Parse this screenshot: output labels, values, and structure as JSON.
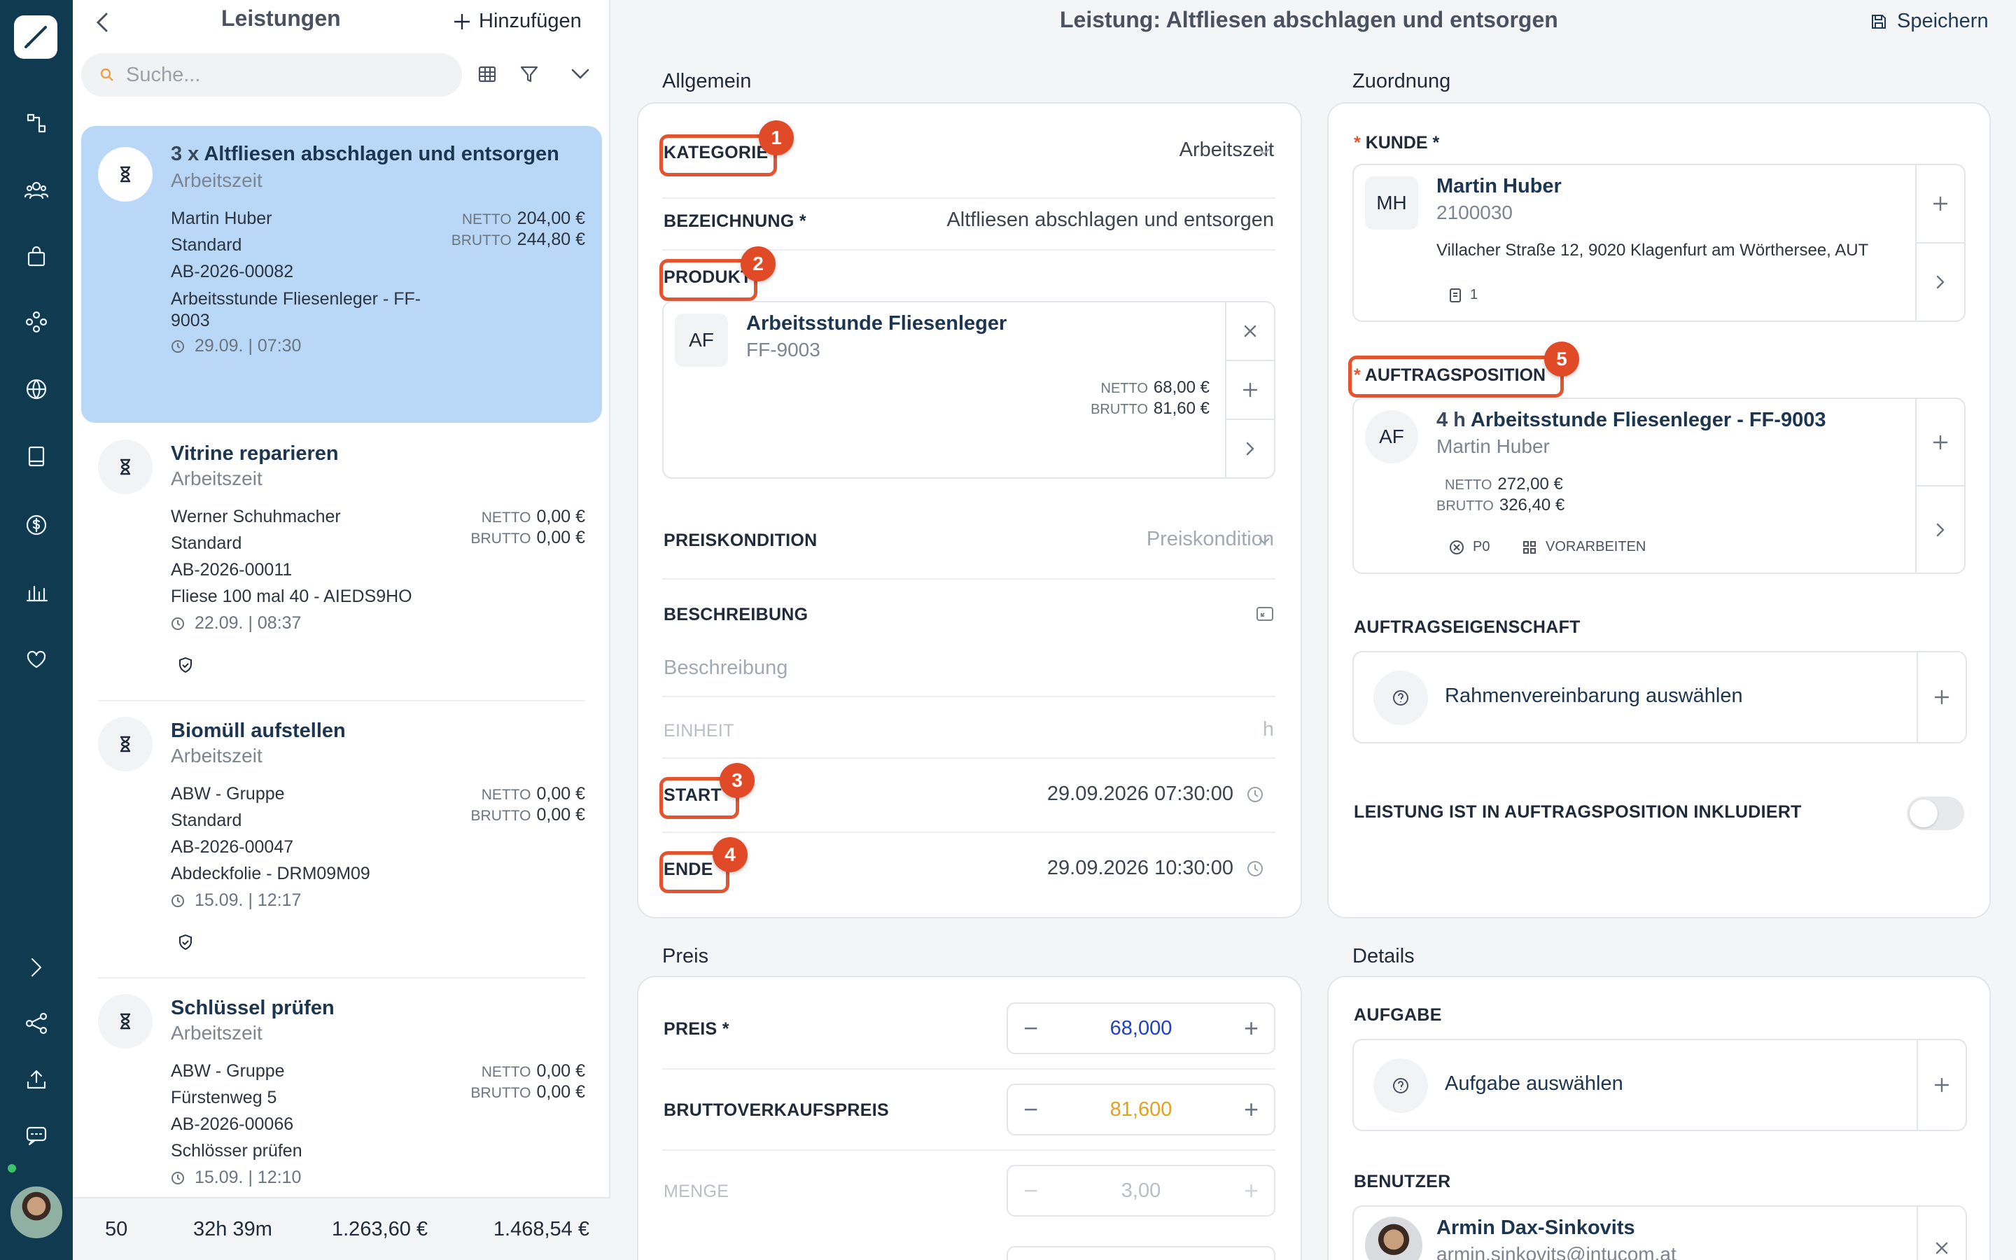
{
  "list": {
    "title": "Leistungen",
    "add_label": "Hinzufügen",
    "search_placeholder": "Suche...",
    "items": [
      {
        "title_prefix": "3 x",
        "title": "Altfliesen abschlagen und entsorgen",
        "category": "Arbeitszeit",
        "customer": "Martin Huber",
        "kind": "Standard",
        "code": "AB-2026-00082",
        "product": "Arbeitsstunde Fliesenleger - FF-9003",
        "time": "29.09. | 07:30",
        "netto": "204,00 €",
        "brutto": "244,80 €"
      },
      {
        "title": "Vitrine reparieren",
        "category": "Arbeitszeit",
        "customer": "Werner Schuhmacher",
        "kind": "Standard",
        "code": "AB-2026-00011",
        "product": "Fliese 100 mal 40 - AIEDS9HO",
        "time": "22.09. | 08:37",
        "netto": "0,00 €",
        "brutto": "0,00 €"
      },
      {
        "title": "Biomüll aufstellen",
        "category": "Arbeitszeit",
        "customer": "ABW - Gruppe",
        "kind": "Standard",
        "code": "AB-2026-00047",
        "product": "Abdeckfolie - DRM09M09",
        "time": "15.09. | 12:17",
        "netto": "0,00 €",
        "brutto": "0,00 €"
      },
      {
        "title": "Schlüssel prüfen",
        "category": "Arbeitszeit",
        "customer": "ABW - Gruppe",
        "kind": "Fürstenweg 5",
        "code": "AB-2026-00066",
        "product": "Schlösser prüfen",
        "time": "15.09. | 12:10",
        "netto": "0,00 €",
        "brutto": "0,00 €"
      }
    ],
    "netto_label": "NETTO",
    "brutto_label": "BRUTTO",
    "footer": {
      "count": "50",
      "hours": "32h 39m",
      "netto": "1.263,60 €",
      "brutto": "1.468,54 €"
    }
  },
  "header": {
    "title": "Leistung: Altfliesen abschlagen und entsorgen",
    "save_label": "Speichern"
  },
  "allgemein": {
    "heading": "Allgemein",
    "kategorie_label": "KATEGORIE",
    "kategorie_value": "Arbeitszeit",
    "bezeichnung_label": "BEZEICHNUNG *",
    "bezeichnung_value": "Altfliesen abschlagen und entsorgen",
    "produkt_label": "PRODUKT",
    "produkt": {
      "badge": "AF",
      "name": "Arbeitsstunde Fliesenleger",
      "code": "FF-9003",
      "netto": "68,00 €",
      "brutto": "81,60 €"
    },
    "preiskondition_label": "PREISKONDITION",
    "preiskondition_placeholder": "Preiskondition",
    "beschreibung_label": "BESCHREIBUNG",
    "beschreibung_placeholder": "Beschreibung",
    "einheit_label": "EINHEIT",
    "einheit_value": "h",
    "start_label": "START",
    "start_value": "29.09.2026 07:30:00",
    "ende_label": "ENDE",
    "ende_value": "29.09.2026 10:30:00"
  },
  "zuordnung": {
    "heading": "Zuordnung",
    "kunde_label": "KUNDE *",
    "kunde": {
      "badge": "MH",
      "name": "Martin Huber",
      "number": "2100030",
      "address": "Villacher Straße 12, 9020 Klagenfurt am Wörthersee, AUT",
      "doc_count": "1"
    },
    "auftragsposition_label": "AUFTRAGSPOSITION",
    "auftragsposition": {
      "badge": "AF",
      "qty": "4 h",
      "name": "Arbeitsstunde Fliesenleger - FF-9003",
      "customer": "Martin Huber",
      "netto": "272,00 €",
      "brutto": "326,40 €",
      "tag1": "P0",
      "tag2": "VORARBEITEN"
    },
    "auftragseigenschaft_label": "AUFTRAGSEIGENSCHAFT",
    "rahmen_label": "Rahmenvereinbarung auswählen",
    "inkludiert_label": "LEISTUNG IST IN AUFTRAGSPOSITION INKLUDIERT"
  },
  "preis": {
    "heading": "Preis",
    "preis_label": "PREIS *",
    "preis_value": "68,000",
    "brutto_label": "BRUTTOVERKAUFSPREIS",
    "brutto_value": "81,600",
    "menge_label": "MENGE",
    "menge_value": "3,00"
  },
  "details": {
    "heading": "Details",
    "aufgabe_label": "AUFGABE",
    "aufgabe_placeholder": "Aufgabe auswählen",
    "benutzer_label": "BENUTZER",
    "user_name": "Armin Dax-Sinkovits",
    "user_email": "armin.sinkovits@intucom.at"
  },
  "annotations": [
    "1",
    "2",
    "3",
    "4",
    "5"
  ],
  "colors": {
    "rail": "#0f3a4f",
    "selected": "#b9d8f7",
    "highlight": "#e5532f",
    "preis_value": "#1f3fc4",
    "brutto_value": "#e0a31b"
  }
}
